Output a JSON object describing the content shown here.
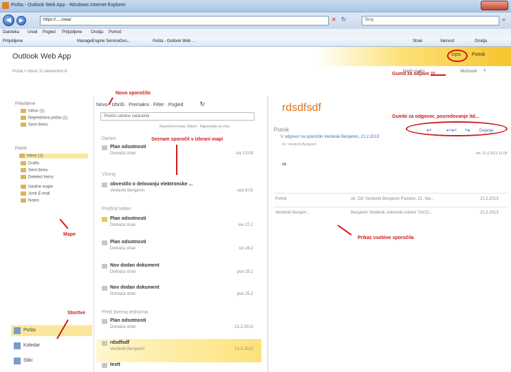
{
  "window": {
    "title": "Pošta - Outlook Web App - Windows Internet Explorer"
  },
  "browser": {
    "address": "https://...../owa/",
    "search_placeholder": "Bing",
    "menu": [
      "Datoteka",
      "Uredi",
      "Pogled",
      "Priljubljene",
      "Orodja",
      "Pomoč"
    ],
    "favbar": [
      "Priljubljene",
      "ManageEngine ServiceDes...",
      "Pošta - Outlook Web ...",
      "Stran",
      "Varnost",
      "Orodja"
    ]
  },
  "owa": {
    "logo": "Outlook Web App",
    "signout": "Izpis",
    "user": "Potnik",
    "breadcrumb": "Pošta > Inbox 11 elementov 6",
    "reading_actions": [
      "Najdi osebo",
      "Možnosti"
    ]
  },
  "folders": {
    "favorites_label": "Priljubljene",
    "favorites": [
      "Inbox (1)",
      "Neprebrana pošta (1)",
      "Sent Items"
    ],
    "account_label": "Potnik",
    "account": [
      "Inbox (1)",
      "Drafts",
      "Sent Items",
      "Deleted Items",
      "Iskalne mape",
      "Junk E-mail",
      "Notes"
    ]
  },
  "bottom_nav": [
    "Pošta",
    "Koledar",
    "Stiki"
  ],
  "toolbar": {
    "new": "Novo",
    "delete": "Izbriši",
    "move": "Premakni",
    "filter": "Filter",
    "view": "Pogled"
  },
  "search": {
    "placeholder": "Preišči celotno nabiralnik"
  },
  "sort_hint": "Razvrščeni vrsta: Datum  ·  Najnovejše na vrhu",
  "groups": {
    "today": "Danes",
    "yesterday": "Včeraj",
    "last_week": "Prejšnji teden",
    "older": "Pred dvema tednoma"
  },
  "messages": [
    {
      "subject": "Plan odsotnosti",
      "from": "Domača stran",
      "date": "sre 13.08"
    },
    {
      "subject": "obvestilo o delovanju elektronske ...",
      "from": "Verdenik Benjamin",
      "date": "ned 8:01"
    },
    {
      "subject": "Plan odsotnosti",
      "from": "Domača stran",
      "date": "sre 27.2"
    },
    {
      "subject": "Plan odsotnosti",
      "from": "Domača stran",
      "date": "tor 26.2"
    },
    {
      "subject": "Nov dodan dokument",
      "from": "Domača stran",
      "date": "pon 25.2"
    },
    {
      "subject": "Nov dodan dokument",
      "from": "Domača stran",
      "date": "pon 25.2"
    },
    {
      "subject": "Plan odsotnosti",
      "from": "Domača stran",
      "date": "21.2.2013"
    },
    {
      "subject": "rdsdfsdf",
      "from": "Verdenik Benjamin",
      "date": "21.2.2013"
    },
    {
      "subject": "testt",
      "from": "",
      "date": ""
    }
  ],
  "reading": {
    "subject": "rdsdfsdf",
    "sender": "Potnik",
    "thread_line": "V odgovor na sporočilo Verdenik Benjamin, 21.2.2013",
    "to": "Za: Verdenik Benjamin",
    "date": "čet, 21.2.2013 12:08",
    "body": "ok",
    "forward": "Dejanja",
    "thread": [
      {
        "from": "Potnik",
        "preview": "ok. Od: Verdenik Benjamin Poslano: 21. feb...",
        "date": "21.2.2013"
      },
      {
        "from": "Verdenik Benjam...",
        "preview": "Benjamin Verdenik sistemski inženir TACO...",
        "date": "21.2.2013"
      }
    ]
  },
  "annotations": {
    "new_message": "Novo sporočilo",
    "message_list": "Seznam sporočil v izbrani mapi",
    "folders": "Mape",
    "services": "Storitve",
    "signout_btn": "Gumb za odjavo !!!",
    "reply_btns": "Gumbi za odgovor, posredovanje itd...",
    "message_content": "Prikaz vsebine sporočila"
  },
  "colors": {
    "accent": "#f6c52d",
    "annotation": "#d01818",
    "subject": "#e2700b",
    "link": "#3b6cc1"
  }
}
